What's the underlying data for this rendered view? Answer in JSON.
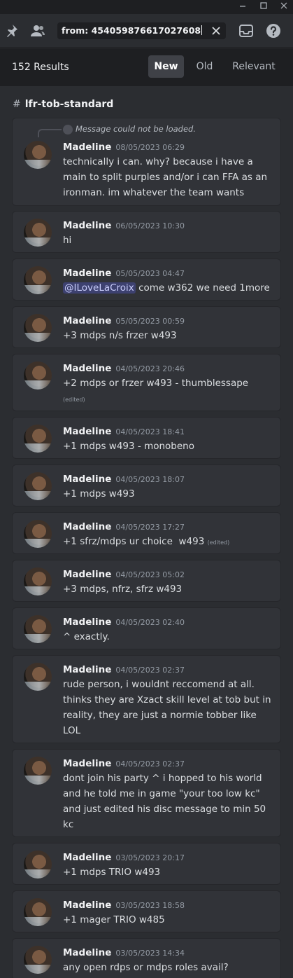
{
  "window": {
    "minimize_icon": "minimize-icon",
    "maximize_icon": "maximize-icon",
    "close_icon": "close-icon"
  },
  "toolbar": {
    "pin_icon": "pin-icon",
    "members_icon": "members-icon",
    "search_value": "from: 454059876617027608",
    "clear_icon": "close-icon",
    "inbox_icon": "inbox-icon",
    "help_icon": "help-icon"
  },
  "results": {
    "count": "152 Results",
    "tabs": [
      "New",
      "Old",
      "Relevant"
    ],
    "active_tab": "New"
  },
  "channel": {
    "name": "lfr-tob-standard"
  },
  "messages": [
    {
      "reply": "Message could not be loaded.",
      "author": "Madeline",
      "timestamp": "08/05/2023 06:29",
      "content": "technically i can. why? because i have a main to split purples and/or i can FFA as an ironman. im whatever the team wants"
    },
    {
      "author": "Madeline",
      "timestamp": "06/05/2023 10:30",
      "content": "hi"
    },
    {
      "author": "Madeline",
      "timestamp": "05/05/2023 04:47",
      "mention": "@ILoveLaCroix",
      "content": " come w362 we need 1more"
    },
    {
      "author": "Madeline",
      "timestamp": "05/05/2023 00:59",
      "content": "+3 mdps n/s frzer w493"
    },
    {
      "author": "Madeline",
      "timestamp": "04/05/2023 20:46",
      "content": "+2 mdps or frzer w493 - thumblessape",
      "edited": "(edited)"
    },
    {
      "author": "Madeline",
      "timestamp": "04/05/2023 18:41",
      "content": "+1 mdps w493 - monobeno"
    },
    {
      "author": "Madeline",
      "timestamp": "04/05/2023 18:07",
      "content": "+1 mdps w493"
    },
    {
      "author": "Madeline",
      "timestamp": "04/05/2023 17:27",
      "content": "+1 sfrz/mdps ur choice  w493",
      "edited": "(edited)"
    },
    {
      "author": "Madeline",
      "timestamp": "04/05/2023 05:02",
      "content": "+3 mdps, nfrz, sfrz w493"
    },
    {
      "author": "Madeline",
      "timestamp": "04/05/2023 02:40",
      "content": "^ exactly."
    },
    {
      "author": "Madeline",
      "timestamp": "04/05/2023 02:37",
      "content": "rude person, i wouldnt reccomend at all. thinks they are Xzact skill level at tob but in reality, they are just a normie tobber like LOL"
    },
    {
      "author": "Madeline",
      "timestamp": "04/05/2023 02:37",
      "content": "dont join his party ^ i hopped to his world and he told me in game \"your too low kc\" and just edited his disc message to min 50 kc"
    },
    {
      "author": "Madeline",
      "timestamp": "03/05/2023 20:17",
      "content": "+1 mdps TRIO w493"
    },
    {
      "author": "Madeline",
      "timestamp": "03/05/2023 18:58",
      "content": "+1 mager TRIO w485"
    },
    {
      "author": "Madeline",
      "timestamp": "03/05/2023 14:34",
      "content": "any open rdps or mdps roles avail?"
    }
  ]
}
